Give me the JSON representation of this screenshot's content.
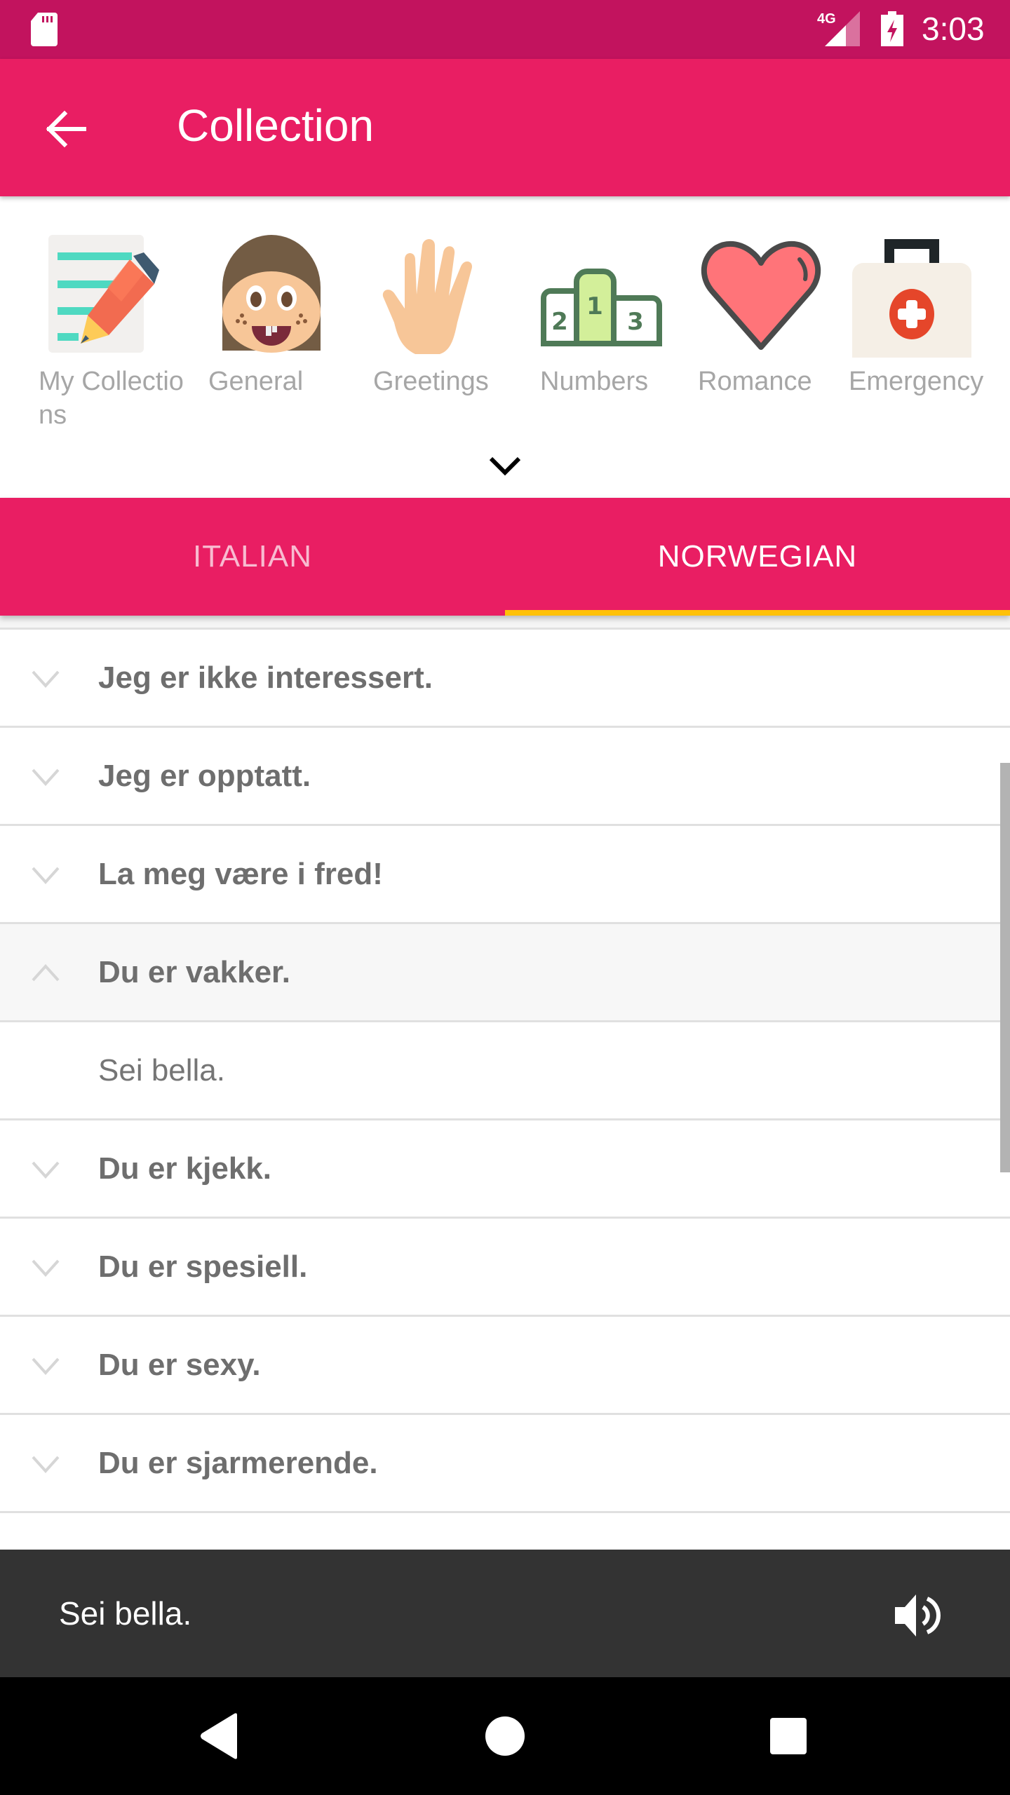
{
  "status_bar": {
    "network": "4G",
    "time": "3:03",
    "icons": [
      "sd-card-icon",
      "signal-icon",
      "battery-charging-icon"
    ]
  },
  "app_bar": {
    "title": "Collection",
    "back_icon": "arrow-back-icon"
  },
  "categories": {
    "items": [
      {
        "label": "My Collections",
        "icon": "notepad-pencil-icon"
      },
      {
        "label": "General",
        "icon": "face-icon"
      },
      {
        "label": "Greetings",
        "icon": "hand-wave-icon"
      },
      {
        "label": "Numbers",
        "icon": "podium-icon"
      },
      {
        "label": "Romance",
        "icon": "heart-icon"
      },
      {
        "label": "Emergency",
        "icon": "first-aid-kit-icon"
      }
    ],
    "expand_icon": "chevron-down-icon"
  },
  "tabs": {
    "items": [
      {
        "label": "ITALIAN",
        "active": false
      },
      {
        "label": "NORWEGIAN",
        "active": true
      }
    ],
    "accent": "#FFC107"
  },
  "phrases": {
    "rows": [
      {
        "text": "Jeg er ikke interessert.",
        "expanded": false
      },
      {
        "text": "Jeg er opptatt.",
        "expanded": false
      },
      {
        "text": "La meg være i fred!",
        "expanded": false
      },
      {
        "text": "Du er vakker.",
        "expanded": true,
        "translation": "Sei bella."
      },
      {
        "text": "Du er kjekk.",
        "expanded": false
      },
      {
        "text": "Du er spesiell.",
        "expanded": false
      },
      {
        "text": "Du er sexy.",
        "expanded": false
      },
      {
        "text": "Du er sjarmerende.",
        "expanded": false
      }
    ]
  },
  "player": {
    "text": "Sei bella.",
    "icon": "speaker-icon"
  },
  "nav_bar": {
    "buttons": [
      "back",
      "home",
      "recents"
    ]
  },
  "colors": {
    "status_bar": "#C2135E",
    "primary": "#E91E63",
    "tab_indicator": "#FFC107",
    "player_bg": "#333333"
  }
}
